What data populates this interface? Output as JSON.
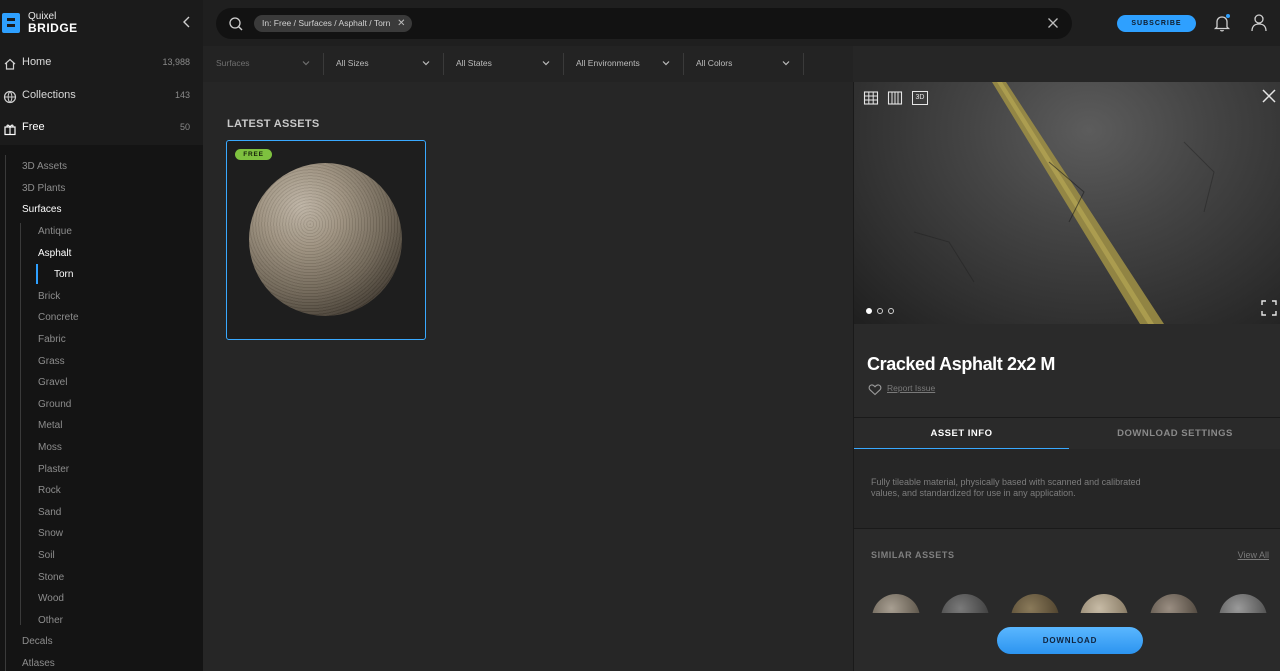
{
  "app": {
    "logo_top": "Quixel",
    "logo_bottom": "BRIDGE"
  },
  "sidebar": {
    "main": [
      {
        "label": "Home",
        "count": "13,988",
        "icon": "home-icon"
      },
      {
        "label": "Collections",
        "count": "143",
        "icon": "collections-icon"
      },
      {
        "label": "Free",
        "count": "50",
        "icon": "gift-icon"
      }
    ],
    "categories": [
      "3D Assets",
      "3D Plants",
      "Surfaces"
    ],
    "surfaces": [
      "Antique",
      "Asphalt",
      "Brick",
      "Concrete",
      "Fabric",
      "Grass",
      "Gravel",
      "Ground",
      "Metal",
      "Moss",
      "Plaster",
      "Rock",
      "Sand",
      "Snow",
      "Soil",
      "Stone",
      "Wood",
      "Other"
    ],
    "asphalt_child": "Torn",
    "more": [
      "Decals",
      "Atlases"
    ]
  },
  "search": {
    "chip": "In: Free / Surfaces / Asphalt / Torn"
  },
  "header": {
    "subscribe": "SUBSCRIBE"
  },
  "filters": [
    {
      "label": "Surfaces"
    },
    {
      "label": "All Sizes"
    },
    {
      "label": "All States"
    },
    {
      "label": "All Environments"
    },
    {
      "label": "All Colors"
    }
  ],
  "content": {
    "section_title": "LATEST ASSETS",
    "card_badge": "FREE"
  },
  "detail": {
    "title": "Cracked Asphalt 2x2 M",
    "report": "Report Issue",
    "view_3d": "3D",
    "tabs": [
      "ASSET INFO",
      "DOWNLOAD SETTINGS"
    ],
    "description": "Fully tileable material, physically based with scanned and calibrated values, and standardized for use in any application.",
    "similar_title": "SIMILAR ASSETS",
    "view_all": "View All",
    "download": "DOWNLOAD",
    "slide_count": 3,
    "active_slide": 1
  },
  "colors": {
    "accent": "#2ea0ff",
    "free_badge": "#7ec13f",
    "road_line": "#b8a84e"
  }
}
